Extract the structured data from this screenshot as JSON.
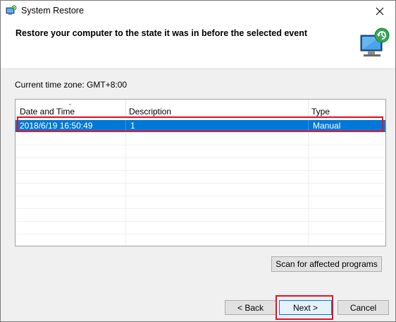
{
  "window": {
    "title": "System Restore"
  },
  "header": {
    "title": "Restore your computer to the state it was in before the selected event"
  },
  "timezone": {
    "label": "Current time zone: GMT+8:00"
  },
  "table": {
    "columns": [
      "Date and Time",
      "Description",
      "Type"
    ],
    "rows": [
      {
        "date": "2018/6/19 16:50:49",
        "description": "1",
        "type": "Manual",
        "selected": true
      }
    ]
  },
  "buttons": {
    "scan": "Scan for affected programs",
    "back": "< Back",
    "next": "Next >",
    "cancel": "Cancel"
  },
  "icons": {
    "close": "close-icon",
    "app": "system-restore-icon",
    "header": "restore-computer-icon",
    "sort": "sort-descending-icon"
  },
  "colors": {
    "selection": "#0078d7",
    "highlight": "#e81123"
  }
}
